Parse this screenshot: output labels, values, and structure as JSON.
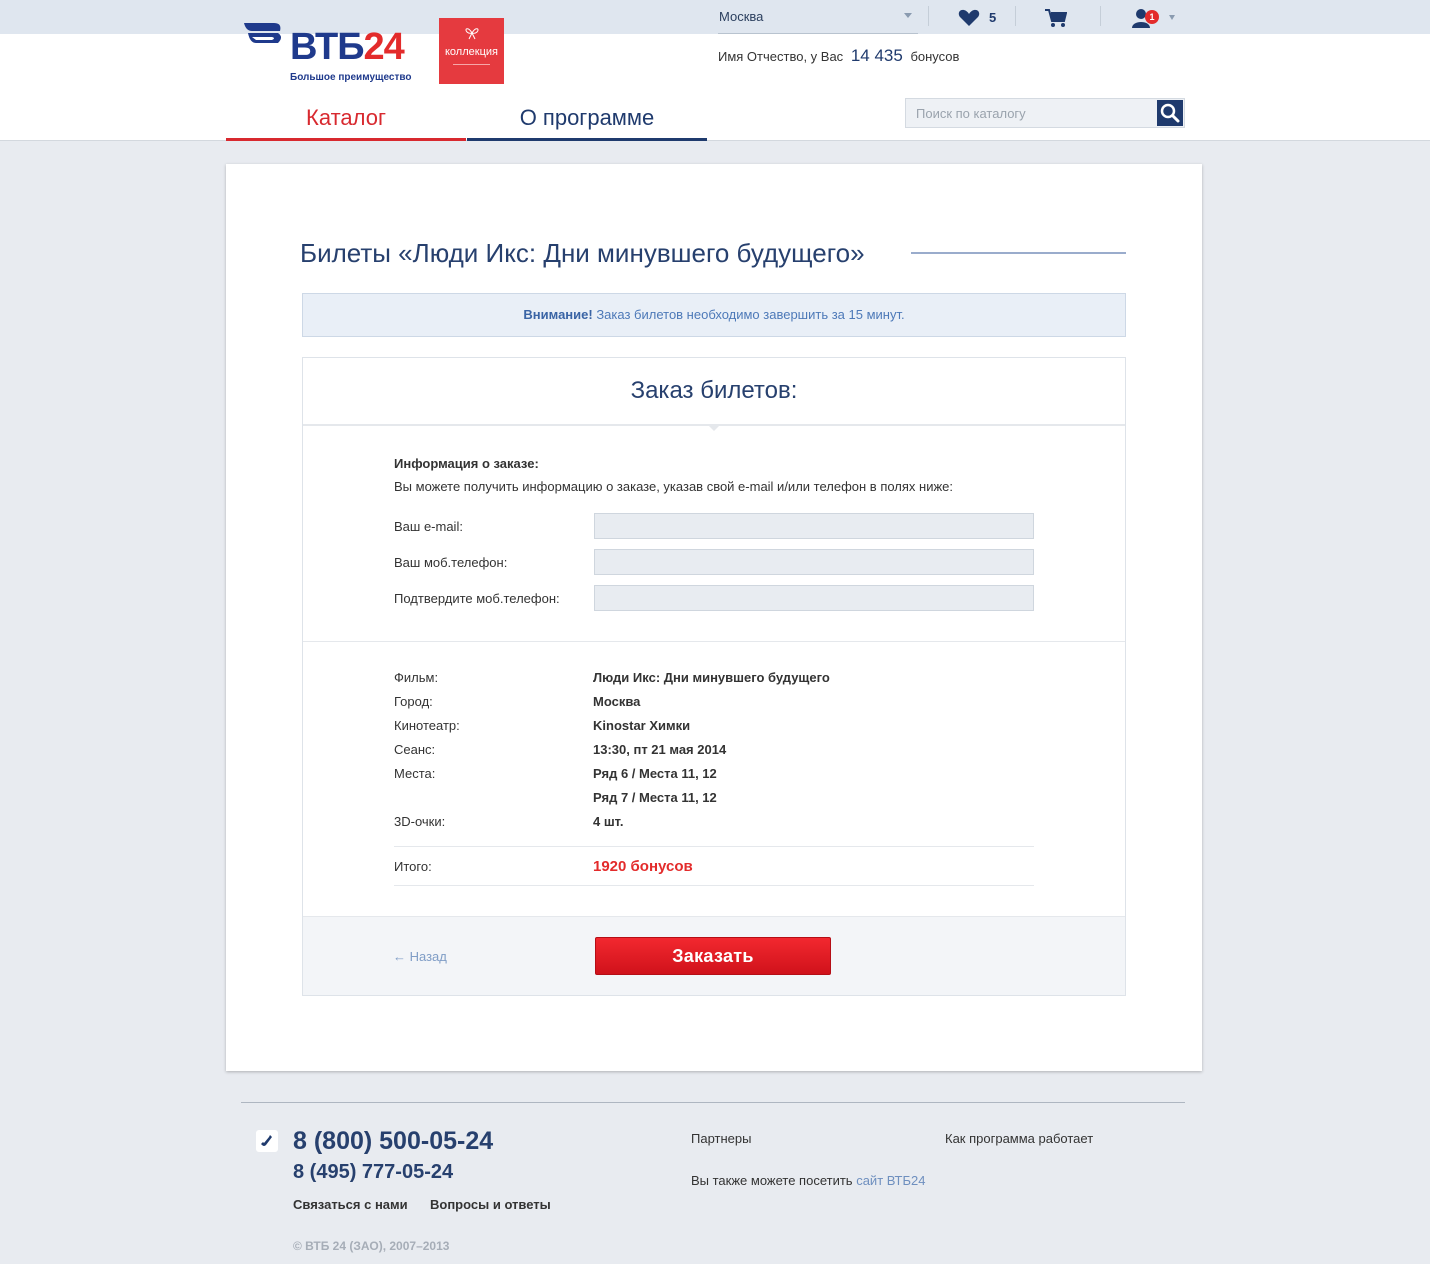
{
  "header": {
    "logo_main": "ВТБ",
    "logo_num": "24",
    "logo_slogan": "Большое преимущество",
    "badge_label": "коллекция",
    "city": "Москва",
    "favorites_count": "5",
    "notifications_count": "1",
    "greeting_prefix": "Имя Отчество, у Вас",
    "bonus_amount": "14 435",
    "bonus_suffix": "бонусов"
  },
  "nav": {
    "catalog": "Каталог",
    "about": "О программе",
    "search_placeholder": "Поиск по каталогу"
  },
  "page": {
    "title": "Билеты «Люди Икс: Дни минувшего будущего»",
    "notice_bold": "Внимание!",
    "notice_text": "Заказ билетов необходимо завершить за 15 минут."
  },
  "order": {
    "heading": "Заказ билетов:",
    "info_title": "Информация о заказе:",
    "info_desc": "Вы можете получить информацию о заказе, указав свой e-mail и/или телефон в полях ниже:",
    "fields": {
      "email_label": "Ваш e-mail:",
      "phone_label": "Ваш моб.телефон:",
      "phone_confirm_label": "Подтвердите моб.телефон:"
    },
    "details": {
      "film_label": "Фильм:",
      "film": "Люди Икс: Дни минувшего будущего",
      "city_label": "Город:",
      "city": "Москва",
      "cinema_label": "Кинотеатр:",
      "cinema": "Kinostar Химки",
      "session_label": "Сеанс:",
      "session": "13:30, пт 21 мая 2014",
      "seats_label": "Места:",
      "seats_1": "Ряд 6 / Места 11, 12",
      "seats_2": "Ряд 7 / Места 11, 12",
      "glasses_label": "3D-очки:",
      "glasses": "4 шт."
    },
    "total_label": "Итого:",
    "total_value": "1920 бонусов",
    "back": "← Назад",
    "submit": "Заказать"
  },
  "footer": {
    "phone_main": "8 (800) 500-05-24",
    "phone_alt": "8 (495) 777-05-24",
    "contact": "Связаться с нами",
    "faq": "Вопросы и ответы",
    "partners": "Партнеры",
    "how_it_works": "Как программа работает",
    "visit_prefix": "Вы также можете посетить",
    "visit_link": "сайт ВТБ24",
    "copyright": "© ВТБ 24 (ЗАО), 2007–2013"
  },
  "colors": {
    "brand_blue": "#1f3a6d",
    "brand_red": "#e32b2b",
    "accent_link": "#6e8fbf"
  }
}
